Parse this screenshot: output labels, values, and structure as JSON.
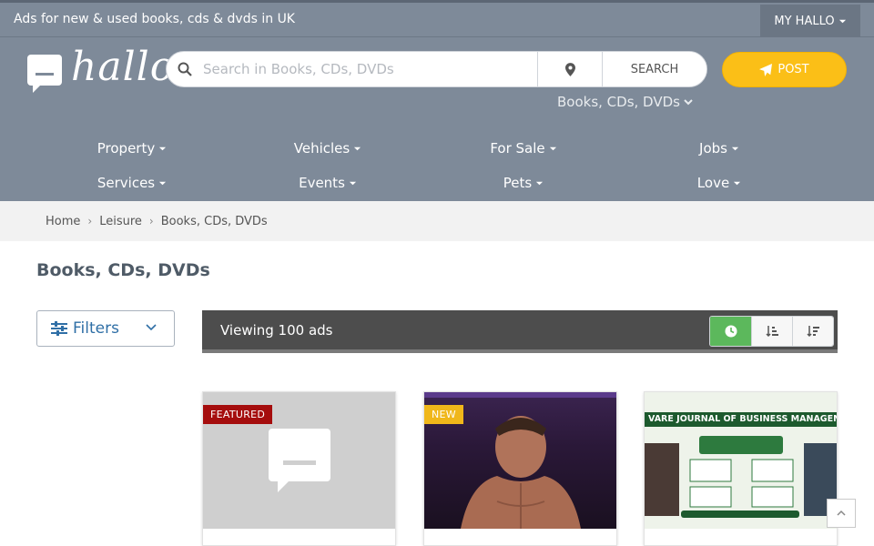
{
  "topbar": {
    "tagline": "Ads for new & used books, cds & dvds in UK",
    "my_hallo": "MY HALLO"
  },
  "brand": {
    "logo_text": "hallo"
  },
  "search": {
    "placeholder": "Search in Books, CDs, DVDs",
    "button_label": "SEARCH",
    "category": "Books, CDs, DVDs"
  },
  "post_button": "POST",
  "nav": {
    "items": [
      {
        "label": "Property"
      },
      {
        "label": "Vehicles"
      },
      {
        "label": "For Sale"
      },
      {
        "label": "Jobs"
      },
      {
        "label": "Services"
      },
      {
        "label": "Events"
      },
      {
        "label": "Pets"
      },
      {
        "label": "Love"
      }
    ]
  },
  "breadcrumb": [
    "Home",
    "Leisure",
    "Books, CDs, DVDs"
  ],
  "page_title": "Books, CDs, DVDs",
  "filters_label": "Filters",
  "listing": {
    "viewing": "Viewing 100 ads"
  },
  "cards": [
    {
      "badge": "FEATURED",
      "badge_color": "#a50d0d"
    },
    {
      "badge": "NEW",
      "badge_color": "#f0b71a"
    },
    {
      "badge": "",
      "header_text": "VARE JOURNAL OF BUSINESS MANAGEMENT (I"
    }
  ],
  "colors": {
    "header_bg": "#7e8a99",
    "post": "#fbbf17",
    "active_sort": "#5cb85c"
  }
}
